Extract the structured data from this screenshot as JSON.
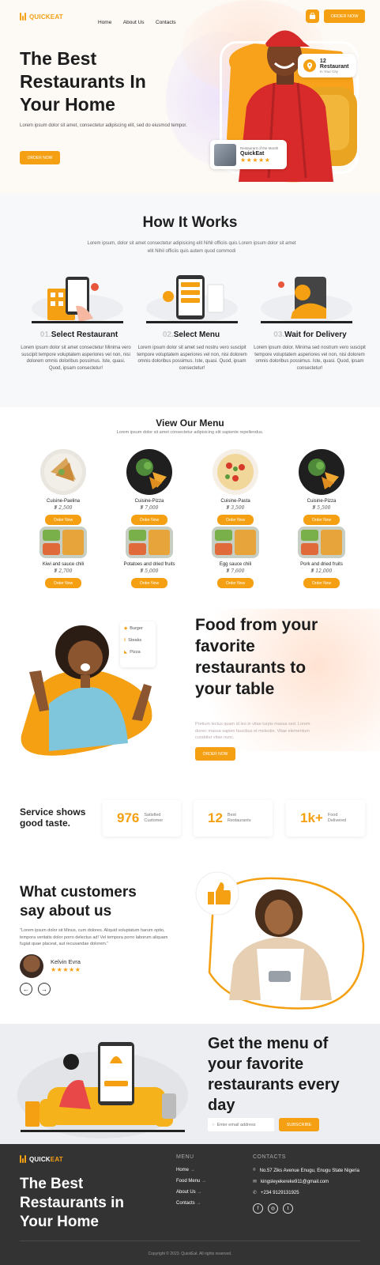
{
  "brand": {
    "name_part1": "QUICK",
    "name_part2": "EAT"
  },
  "nav": {
    "home": "Home",
    "about": "About Us",
    "contacts": "Contacts",
    "order_btn": "ORDER NOW"
  },
  "hero": {
    "title_l1": "The Best",
    "title_l2": "Restaurants In",
    "title_l3": "Your Home",
    "text": "Lorem ipsum dolor sit amet, consectetur adipiscing elit, sed do eiusmod tempor.",
    "order_btn": "ORDER NOW",
    "badge_title": "12 Restaurant",
    "badge_sub": "In Your City",
    "rest_label": "Restaurant of the Month",
    "rest_name": "QuickEat",
    "rest_stars": "★★★★★"
  },
  "how": {
    "title": "How It Works",
    "text": "Lorem ipsum, dolor sit amet consectetur adipisicing elit Nihil officiis quis Lorem ipsum dolor sit amet elit Nihil officiis quis autem quod commodi",
    "steps": [
      {
        "num": "01.",
        "title": "Select Restaurant",
        "text": "Lorem ipsum dolor sit amet consectetur Minima vero suscipit tempore voluptatem asperiores vel non, nisi dolorem omnis doloribus possimus. Iste, quasi. Quod, ipsam consectetur!"
      },
      {
        "num": "02.",
        "title": "Select Menu",
        "text": "Lorem ipsum dolor sit amet sed nostru vero suscipit tempore voluptatem asperiores vel non, nisi dolorem omnis doloribus possimus. Iste, quasi. Quod, ipsam consectetur!"
      },
      {
        "num": "03.",
        "title": "Wait for Delivery",
        "text": "Lorem ipsum dolor. Minima sed nostrum vero suscipit tempore voluptatem asperiores vel non, nisi dolorem omnis doloribus possimus. Iste, quasi. Quod, ipsam consectetur!"
      }
    ]
  },
  "menu": {
    "title": "View Our Menu",
    "subtitle": "Lorem ipsum dolor sit amet consectetur adipisicing elit sapiente repellendus.",
    "btn": "Order Now",
    "dishes": [
      {
        "name": "Cuisine-Paelina",
        "price": "₦ 2,500"
      },
      {
        "name": "Cuisine-Pizza",
        "price": "₦ 7,000"
      },
      {
        "name": "Cuisine-Pasta",
        "price": "₦ 3,500"
      },
      {
        "name": "Cuisine-Pizza",
        "price": "₦ 5,500"
      },
      {
        "name": "Kiwi and sauce chili",
        "price": "₦ 2,700"
      },
      {
        "name": "Potatoes and dried fruits",
        "price": "₦ 5,000"
      },
      {
        "name": "Egg sauce chili",
        "price": "₦ 7,600"
      },
      {
        "name": "Pork and dried fruits",
        "price": "₦ 12,000"
      }
    ]
  },
  "food": {
    "title_l1": "Food from your",
    "title_l2": "favorite",
    "title_l3": "restaurants to",
    "title_l4": "your table",
    "text": "Pretium lectus quam id leo in vitae turpis massa sed. Lorem donec massa sapien faucibus et molestie. Vitae elementum curabitur vitae nunc.",
    "btn": "ORDER NOW",
    "tags": [
      "Burger",
      "Steaks",
      "Pizza"
    ]
  },
  "stats": {
    "heading_l1": "Service shows",
    "heading_l2": "good taste.",
    "items": [
      {
        "num": "976",
        "l1": "Satisfied",
        "l2": "Customer"
      },
      {
        "num": "12",
        "l1": "Best",
        "l2": "Restaurants"
      },
      {
        "num": "1k+",
        "l1": "Food",
        "l2": "Delivered"
      }
    ]
  },
  "testimonial": {
    "title_l1": "What customers",
    "title_l2": "say about us",
    "quote": "\"Lorem ipsum dolor sit Minus, cum dolores. Aliquid voluptatum harum optio, tempora veritatis dolor porro delectus ad! Vel tempora porro laborum aliquam fugiat quae placeat, aut recusandae dolorem.\"",
    "name": "Kelvin Evra",
    "stars": "★★★★★",
    "prev": "←",
    "next": "→"
  },
  "subscribe": {
    "title_l1": "Get the menu of",
    "title_l2": "your favorite",
    "title_l3": "restaurants every",
    "title_l4": "day",
    "placeholder": "Enter email address",
    "btn": "SUBSCRIBE",
    "phone_btn": "SUBSCRIBE"
  },
  "footer": {
    "title_l1": "The Best",
    "title_l2": "Restaurants in",
    "title_l3": "Your Home",
    "menu_title": "MENU",
    "links": [
      "Home",
      "Food Menu",
      "About Us",
      "Contacts"
    ],
    "contacts_title": "CONTACTS",
    "address": "No.57 Ziks Avenue Enugu, Enugu State Nigeria",
    "email": "kingsleyekereke911@gmail.com",
    "phone": "+234 9129131925",
    "copyright": "Copyright © 2023. QuickEat. All rights reserved."
  },
  "colors": {
    "accent": "#f4a012",
    "dark": "#333333",
    "light_bg": "#f7f8fa"
  }
}
